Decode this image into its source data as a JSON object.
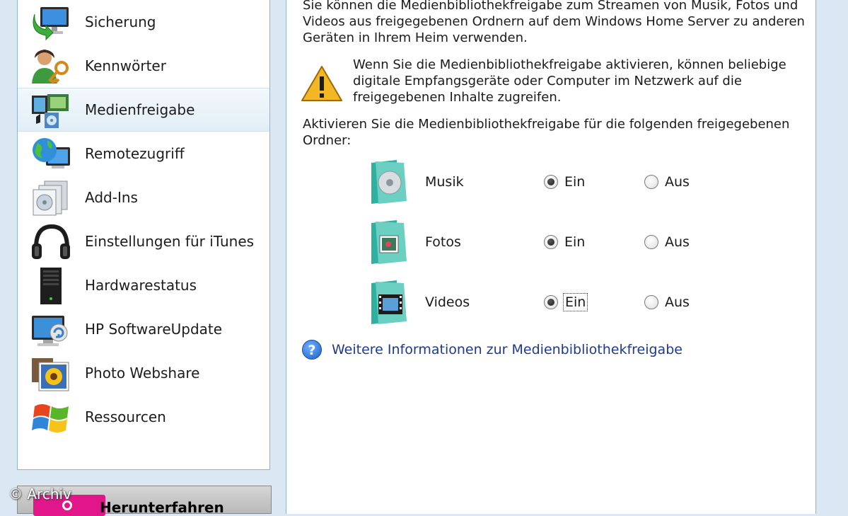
{
  "sidebar": {
    "items": [
      {
        "label": "Sicherung",
        "icon": "backup-computer-icon"
      },
      {
        "label": "Kennwörter",
        "icon": "user-key-icon"
      },
      {
        "label": "Medienfreigabe",
        "icon": "media-share-icon",
        "active": true
      },
      {
        "label": "Remotezugriff",
        "icon": "globe-computer-icon"
      },
      {
        "label": "Add-Ins",
        "icon": "addins-icon"
      },
      {
        "label": "Einstellungen für iTunes",
        "icon": "headphones-icon"
      },
      {
        "label": "Hardwarestatus",
        "icon": "server-tower-icon"
      },
      {
        "label": "HP SoftwareUpdate",
        "icon": "monitor-update-icon"
      },
      {
        "label": "Photo Webshare",
        "icon": "photo-sunflower-icon"
      },
      {
        "label": "Ressourcen",
        "icon": "windows-flag-icon"
      }
    ]
  },
  "footer": {
    "shutdown_label": "Herunterfahren",
    "watermark": "© Archiv"
  },
  "content": {
    "intro": "Sie können die Medienbibliothekfreigabe zum Streamen von Musik, Fotos und Videos aus freigegebenen Ordnern auf dem Windows Home Server zu anderen Geräten in Ihrem Heim verwenden.",
    "warning": "Wenn Sie die Medienbibliothekfreigabe aktivieren, können beliebige digitale Empfangsgeräte oder Computer im Netzwerk auf die freigegebenen Inhalte zugreifen.",
    "activate": "Aktivieren Sie die Medienbibliothekfreigabe für die folgenden freigegebenen Ordner:",
    "folders": [
      {
        "name": "Musik",
        "on_label": "Ein",
        "off_label": "Aus",
        "selected": "Ein"
      },
      {
        "name": "Fotos",
        "on_label": "Ein",
        "off_label": "Aus",
        "selected": "Ein"
      },
      {
        "name": "Videos",
        "on_label": "Ein",
        "off_label": "Aus",
        "selected": "Ein"
      }
    ],
    "help_link": "Weitere Informationen zur Medienbibliothekfreigabe",
    "help_icon": "?"
  },
  "colors": {
    "window_bg": "#dbe7f3",
    "accent_shutdown": "#e0168a",
    "link": "#1d3a8f"
  }
}
